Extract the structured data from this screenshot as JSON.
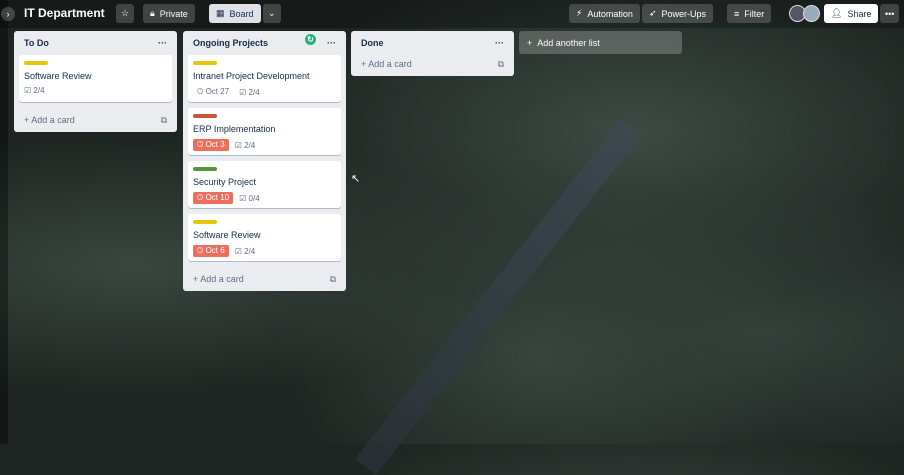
{
  "header": {
    "title": "IT Department",
    "visibility": "Private",
    "view": "Board",
    "automation": "Automation",
    "powerups": "Power-Ups",
    "filter": "Filter",
    "share": "Share"
  },
  "lists": [
    {
      "title": "To Do",
      "add": "Add a card",
      "cards": [
        {
          "title": "Software Review",
          "label_color": "#f5cd47",
          "checklist": "2/4"
        }
      ]
    },
    {
      "title": "Ongoing Projects",
      "add": "Add a card",
      "cards": [
        {
          "title": "Intranet Project Development",
          "label_color": "#e6c60d",
          "due": "Oct 27",
          "overdue": false,
          "checklist": "2/4"
        },
        {
          "title": "ERP Implementation",
          "label_color": "#cf513d",
          "due": "Oct 3",
          "overdue": true,
          "checklist": "2/4"
        },
        {
          "title": "Security Project",
          "label_color": "#519839",
          "due": "Oct 10",
          "overdue": true,
          "checklist": "0/4"
        },
        {
          "title": "Software Review",
          "label_color": "#e6c60d",
          "due": "Oct 6",
          "overdue": true,
          "checklist": "2/4"
        }
      ]
    },
    {
      "title": "Done",
      "add": "Add a card",
      "cards": []
    }
  ],
  "add_list": "Add another list"
}
